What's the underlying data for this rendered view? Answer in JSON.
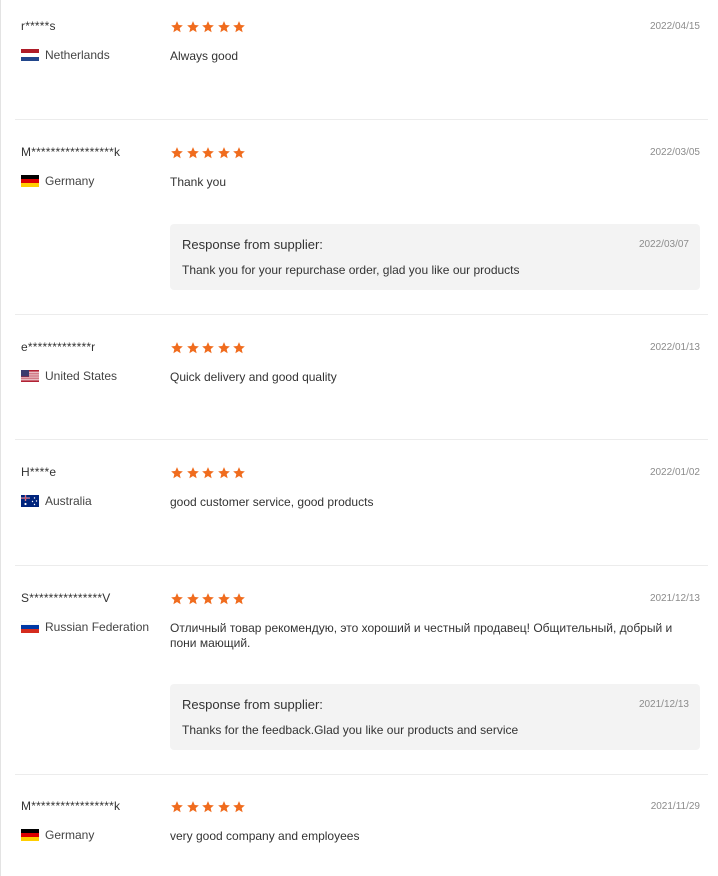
{
  "colors": {
    "star": "#f06c1e",
    "response_bg": "#f3f3f3",
    "divider": "#ececec"
  },
  "reviews": [
    {
      "user": "r*****s",
      "country": "Netherlands",
      "flag": "netherlands-flag-icon",
      "rating": 5,
      "date": "2022/04/15",
      "text": "Always good",
      "response": null
    },
    {
      "user": "M*****************k",
      "country": "Germany",
      "flag": "germany-flag-icon",
      "rating": 5,
      "date": "2022/03/05",
      "text": "Thank you",
      "response": {
        "title": "Response from supplier:",
        "date": "2022/03/07",
        "text": "Thank you for your repurchase order, glad you like our products"
      }
    },
    {
      "user": "e*************r",
      "country": "United States",
      "flag": "usa-flag-icon",
      "rating": 5,
      "date": "2022/01/13",
      "text": "Quick delivery and good quality",
      "response": null
    },
    {
      "user": "H****e",
      "country": "Australia",
      "flag": "australia-flag-icon",
      "rating": 5,
      "date": "2022/01/02",
      "text": "good customer service, good products",
      "response": null
    },
    {
      "user": "S***************V",
      "country": "Russian Federation",
      "flag": "russia-flag-icon",
      "rating": 5,
      "date": "2021/12/13",
      "text": "Отличный товар рекомендую, это хороший и честный продавец! Общительный, добрый и пони мающий.",
      "response": {
        "title": "Response from supplier:",
        "date": "2021/12/13",
        "text": "Thanks for the feedback.Glad you like our products and service"
      }
    },
    {
      "user": "M*****************k",
      "country": "Germany",
      "flag": "germany-flag-icon",
      "rating": 5,
      "date": "2021/11/29",
      "text": "very good company and employees",
      "response": null
    }
  ]
}
